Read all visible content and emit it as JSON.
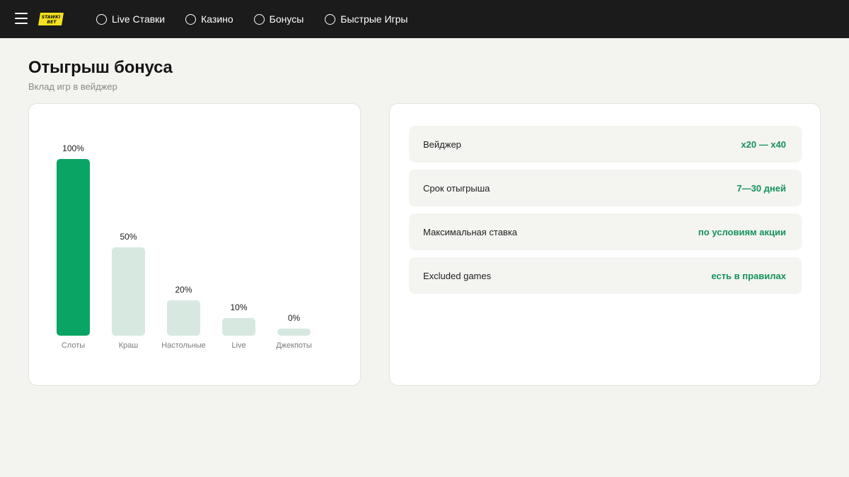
{
  "header": {
    "logo_text_top": "STAWKI",
    "logo_text_bottom": "BET",
    "nav": [
      {
        "label": "Live Ставки"
      },
      {
        "label": "Казино"
      },
      {
        "label": "Бонусы"
      },
      {
        "label": "Быстрые Игры"
      }
    ]
  },
  "page": {
    "title": "Отыгрыш бонуса",
    "subtitle": "Вклад игр в вейджер"
  },
  "chart_data": {
    "type": "bar",
    "categories": [
      "Слоты",
      "Краш",
      "Настольные",
      "Live",
      "Джекпоты"
    ],
    "values": [
      100,
      50,
      20,
      10,
      0
    ],
    "value_labels": [
      "100%",
      "50%",
      "20%",
      "10%",
      "0%"
    ],
    "ylim": [
      0,
      100
    ],
    "highlight_index": 0,
    "colors": {
      "highlight": "#0aa564",
      "default": "#d7e8e0"
    }
  },
  "info": {
    "rows": [
      {
        "label": "Вейджер",
        "value": "x20 — x40"
      },
      {
        "label": "Срок отыгрыша",
        "value": "7—30 дней"
      },
      {
        "label": "Максимальная ставка",
        "value": "по условиям акции"
      },
      {
        "label": "Excluded games",
        "value": "есть в правилах"
      }
    ]
  },
  "colors": {
    "topbar": "#1b1b1b",
    "background": "#f3f3ef",
    "accent": "#15925b",
    "logo_yellow": "#f5e21b"
  }
}
